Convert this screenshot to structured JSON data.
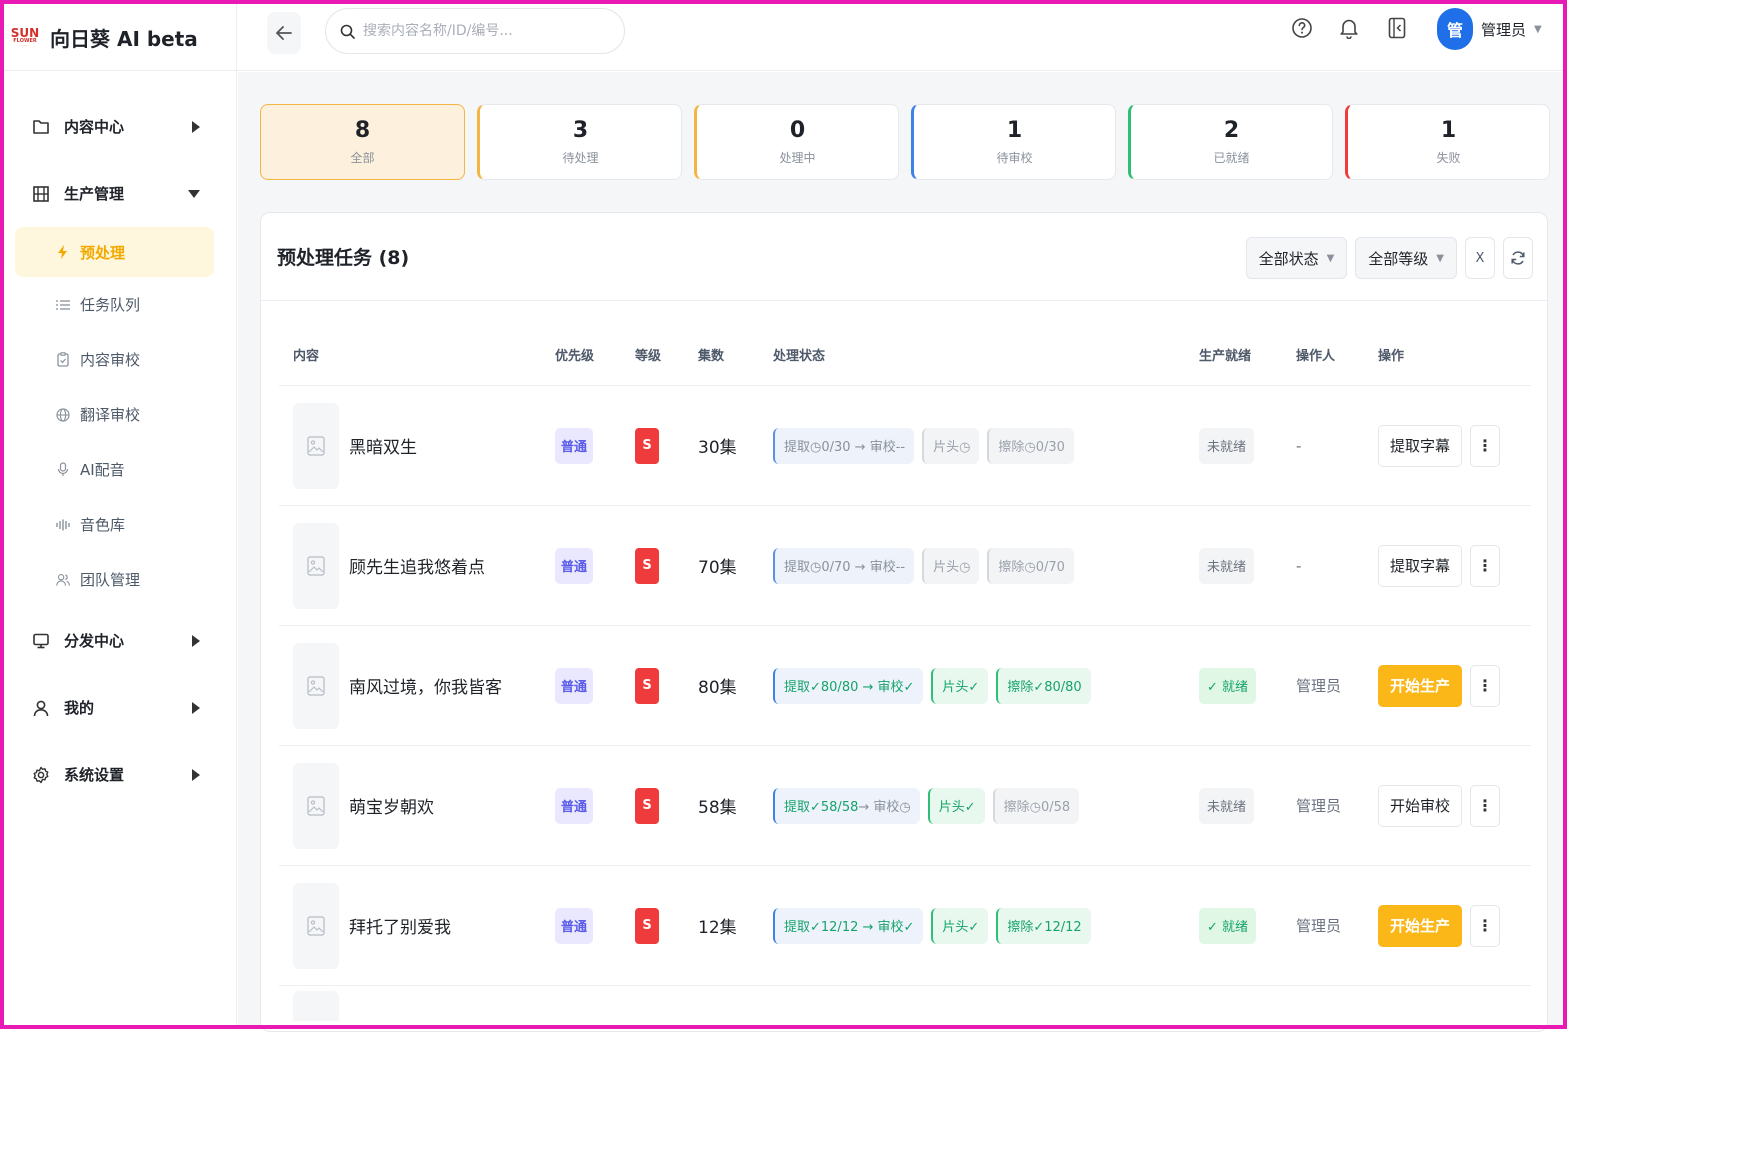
{
  "brand": {
    "logo_line1": "SUN",
    "logo_line2": "FLOWER",
    "logo_line3": "······",
    "name": "向日葵 AI beta"
  },
  "sidebar": {
    "groups": [
      {
        "label": "内容中心",
        "icon": "folder-icon",
        "expanded": false
      },
      {
        "label": "生产管理",
        "icon": "film-icon",
        "expanded": true
      },
      {
        "label": "分发中心",
        "icon": "monitor-icon",
        "expanded": false
      },
      {
        "label": "我的",
        "icon": "user-icon",
        "expanded": false
      },
      {
        "label": "系统设置",
        "icon": "gear-icon",
        "expanded": false
      }
    ],
    "sub_items": [
      {
        "label": "预处理",
        "icon": "lightning-icon",
        "active": true
      },
      {
        "label": "任务队列",
        "icon": "list-icon"
      },
      {
        "label": "内容审校",
        "icon": "clipboard-icon"
      },
      {
        "label": "翻译审校",
        "icon": "globe-icon"
      },
      {
        "label": "AI配音",
        "icon": "microphone-icon"
      },
      {
        "label": "音色库",
        "icon": "waveform-icon"
      },
      {
        "label": "团队管理",
        "icon": "team-icon"
      }
    ]
  },
  "header": {
    "search_placeholder": "搜索内容名称/ID/编号...",
    "user": {
      "avatar_text": "管",
      "name": "管理员"
    }
  },
  "stats": [
    {
      "num": "8",
      "label": "全部",
      "color": "#f3b646",
      "active": true
    },
    {
      "num": "3",
      "label": "待处理",
      "color": "#f3b646"
    },
    {
      "num": "0",
      "label": "处理中",
      "color": "#f3b646"
    },
    {
      "num": "1",
      "label": "待审校",
      "color": "#3d82e6"
    },
    {
      "num": "2",
      "label": "已就绪",
      "color": "#2dbf75"
    },
    {
      "num": "1",
      "label": "失败",
      "color": "#ef3b3b"
    }
  ],
  "card": {
    "title": "预处理任务 (8)",
    "filter_status": "全部状态",
    "filter_level": "全部等级",
    "clear_label": "X"
  },
  "table": {
    "headers": {
      "content": "内容",
      "priority": "优先级",
      "level": "等级",
      "episodes": "集数",
      "status": "处理状态",
      "ready": "生产就绪",
      "operator": "操作人",
      "action": "操作"
    },
    "rows": [
      {
        "title": "黑暗双生",
        "priority": "普通",
        "level": "S",
        "episodes": "30集",
        "extract": "提取◷0/30 → 审校--",
        "intro": "片头◷",
        "erase": "擦除◷0/30",
        "extract_state": "pending",
        "intro_state": "pending",
        "erase_state": "pending",
        "ready": "未就绪",
        "ready_ok": false,
        "operator": "-",
        "action": "提取字幕",
        "action_primary": false
      },
      {
        "title": "顾先生追我悠着点",
        "priority": "普通",
        "level": "S",
        "episodes": "70集",
        "extract": "提取◷0/70 → 审校--",
        "intro": "片头◷",
        "erase": "擦除◷0/70",
        "extract_state": "pending",
        "intro_state": "pending",
        "erase_state": "pending",
        "ready": "未就绪",
        "ready_ok": false,
        "operator": "-",
        "action": "提取字幕",
        "action_primary": false
      },
      {
        "title": "南风过境，你我皆客",
        "priority": "普通",
        "level": "S",
        "episodes": "80集",
        "extract": "提取✓80/80 → 审校✓",
        "intro": "片头✓",
        "erase": "擦除✓80/80",
        "extract_state": "done",
        "intro_state": "done",
        "erase_state": "done",
        "ready": "✓ 就绪",
        "ready_ok": true,
        "operator": "管理员",
        "action": "开始生产",
        "action_primary": true
      },
      {
        "title": "萌宝岁朝欢",
        "priority": "普通",
        "level": "S",
        "episodes": "58集",
        "extract": "提取✓58/58 → 审校◷",
        "intro": "片头✓",
        "erase": "擦除◷0/58",
        "extract_state": "mixed",
        "intro_state": "done",
        "erase_state": "pending",
        "ready": "未就绪",
        "ready_ok": false,
        "operator": "管理员",
        "action": "开始审校",
        "action_primary": false
      },
      {
        "title": "拜托了别爱我",
        "priority": "普通",
        "level": "S",
        "episodes": "12集",
        "extract": "提取✓12/12 → 审校✓",
        "intro": "片头✓",
        "erase": "擦除✓12/12",
        "extract_state": "done",
        "intro_state": "done",
        "erase_state": "done",
        "ready": "✓ 就绪",
        "ready_ok": true,
        "operator": "管理员",
        "action": "开始生产",
        "action_primary": true
      }
    ]
  }
}
